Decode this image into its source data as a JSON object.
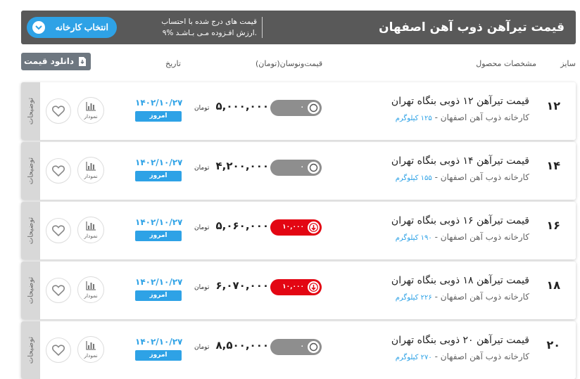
{
  "header": {
    "title": "قیمت تیرآهن ذوب آهن اصفهان",
    "notice_line1": "قیمت های درج شده با احتساب",
    "notice_line2": "۹% ارزش افـزوده مـی بـاشـد.",
    "factory_button": "انتخاب کارخانه"
  },
  "toolbar": {
    "download_label": "دانلود قیمت"
  },
  "columns": {
    "size": "سایز",
    "product": "مشخصات محصول",
    "price_change": "قیمت‌ونوسان(تومان)",
    "date": "تاریخ"
  },
  "rows": [
    {
      "size": "۱۲",
      "name": "قیمت تیرآهن ۱۲ ذوبی بنگاه تهران",
      "factory": "کارخانه ذوب آهن اصفهان - ",
      "weight": "۱۲۵ کیلوگرم",
      "price": "۵,۰۰۰,۰۰۰",
      "unit": "تومان",
      "change": "۰",
      "change_type": "flat",
      "date": "۱۴۰۲/۱۰/۲۷",
      "today": "امروز",
      "chart_label": "نمودار",
      "notes_label": "توضیحات"
    },
    {
      "size": "۱۴",
      "name": "قیمت تیرآهن ۱۴ ذوبی بنگاه تهران",
      "factory": "کارخانه ذوب آهن اصفهان - ",
      "weight": "۱۵۵ کیلوگرم",
      "price": "۴,۲۰۰,۰۰۰",
      "unit": "تومان",
      "change": "۰",
      "change_type": "flat",
      "date": "۱۴۰۲/۱۰/۲۷",
      "today": "امروز",
      "chart_label": "نمودار",
      "notes_label": "توضیحات"
    },
    {
      "size": "۱۶",
      "name": "قیمت تیرآهن ۱۶ ذوبی بنگاه تهران",
      "factory": "کارخانه ذوب آهن اصفهان - ",
      "weight": "۱۹۰ کیلوگرم",
      "price": "۵,۰۶۰,۰۰۰",
      "unit": "تومان",
      "change": "۱۰,۰۰۰",
      "change_type": "down",
      "date": "۱۴۰۲/۱۰/۲۷",
      "today": "امروز",
      "chart_label": "نمودار",
      "notes_label": "توضیحات"
    },
    {
      "size": "۱۸",
      "name": "قیمت تیرآهن ۱۸ ذوبی بنگاه تهران",
      "factory": "کارخانه ذوب آهن اصفهان - ",
      "weight": "۲۲۶ کیلوگرم",
      "price": "۶,۰۷۰,۰۰۰",
      "unit": "تومان",
      "change": "۱۰,۰۰۰",
      "change_type": "down",
      "date": "۱۴۰۲/۱۰/۲۷",
      "today": "امروز",
      "chart_label": "نمودار",
      "notes_label": "توضیحات"
    },
    {
      "size": "۲۰",
      "name": "قیمت تیرآهن ۲۰ ذوبی بنگاه تهران",
      "factory": "کارخانه ذوب آهن اصفهان - ",
      "weight": "۲۷۰ کیلوگرم",
      "price": "۸,۵۰۰,۰۰۰",
      "unit": "تومان",
      "change": "۰",
      "change_type": "flat",
      "date": "۱۴۰۲/۱۰/۲۷",
      "today": "امروز",
      "chart_label": "نمودار",
      "notes_label": "توضیحات"
    }
  ],
  "colors": {
    "header_bg": "#595959",
    "accent_blue": "#2ea2e6",
    "down_red": "#e30613",
    "flat_gray": "#8e8e8e"
  },
  "icons": {
    "factory_button": "chevron-down-icon",
    "download": "file-download-icon",
    "favorite": "heart-icon",
    "chart": "bar-chart-icon",
    "down_change": "arrow-down-circle-icon",
    "flat_change": "circle-icon"
  }
}
